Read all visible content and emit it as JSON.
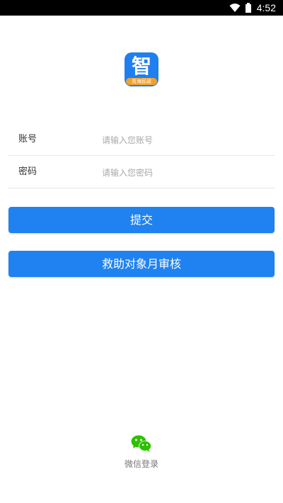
{
  "status_bar": {
    "time": "4:52",
    "icons": [
      "wifi-icon",
      "battery-icon"
    ]
  },
  "logo": {
    "glyph": "智",
    "ribbon_text": "青海民政"
  },
  "form": {
    "account": {
      "label": "账号",
      "placeholder": "请输入您账号",
      "value": ""
    },
    "password": {
      "label": "密码",
      "placeholder": "请输入您密码",
      "value": ""
    }
  },
  "buttons": {
    "submit_label": "提交",
    "audit_label": "救助对象月审核"
  },
  "wechat": {
    "label": "微信登录",
    "icon": "wechat-icon"
  },
  "colors": {
    "primary": "#1f82f0",
    "logo_ribbon": "#f2a12b",
    "wechat_green": "#2dc100"
  }
}
